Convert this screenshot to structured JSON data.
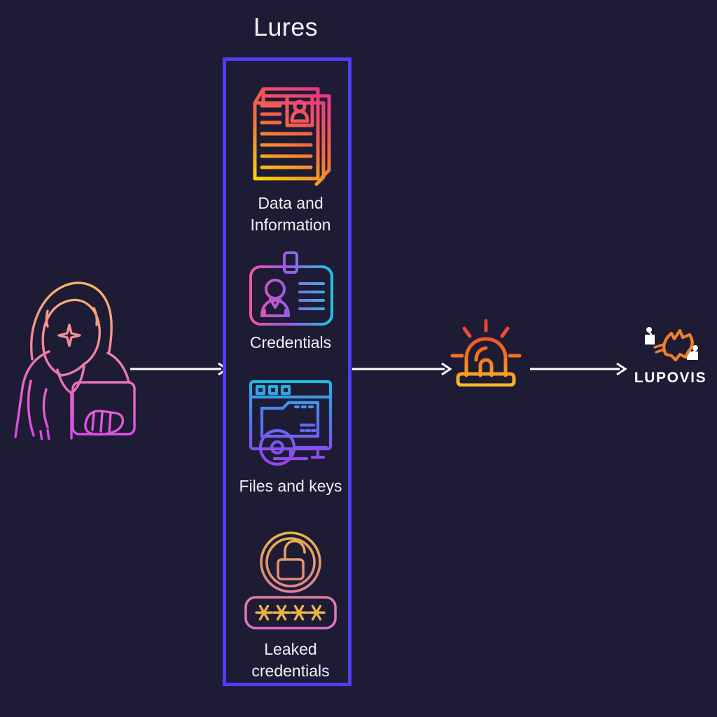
{
  "diagram": {
    "title": "Lures",
    "background_color": "#1e1b35",
    "panel_border_color": "#4f3ef5",
    "arrow_color": "#ffffff",
    "label_color": "#f2f0f7"
  },
  "actor": {
    "name": "hooded-attacker",
    "icon": "hacker-with-laptop-icon",
    "gradient_from": "#f6c453",
    "gradient_to": "#d946ef"
  },
  "lures": {
    "panel_label": "Lures",
    "items": [
      {
        "label": "Data and\nInformation",
        "label_line1": "Data and",
        "label_line2": "Information",
        "icon": "stacked-documents-icon",
        "gradient_from": "#ec4899",
        "gradient_to": "#fbbf24"
      },
      {
        "label": "Credentials",
        "label_line1": "Credentials",
        "label_line2": "",
        "icon": "id-badge-icon",
        "gradient_from": "#f0569f",
        "gradient_to": "#22c4e0"
      },
      {
        "label": "Files and  keys",
        "label_line1": "Files and  keys",
        "label_line2": "",
        "icon": "browser-folder-key-icon",
        "gradient_from": "#22b8e0",
        "gradient_to": "#a23ef0"
      },
      {
        "label": "Leaked\ncredentials",
        "label_line1": "Leaked",
        "label_line2": "credentials",
        "icon": "unlocked-padlock-password-icon",
        "gradient_from": "#e8b44a",
        "gradient_to": "#e06fd0"
      }
    ]
  },
  "alert": {
    "icon": "siren-alarm-icon",
    "gradient_from": "#e8333a",
    "gradient_to": "#fbbf24"
  },
  "brand": {
    "wordmark": "LUPOVIS",
    "icon": "lupovis-wolf-logo",
    "accent_color": "#f2802a",
    "text_color": "#ffffff"
  },
  "flow": {
    "arrows": [
      {
        "name": "attacker-to-lures"
      },
      {
        "name": "lures-to-alert"
      },
      {
        "name": "alert-to-lupovis"
      }
    ]
  }
}
